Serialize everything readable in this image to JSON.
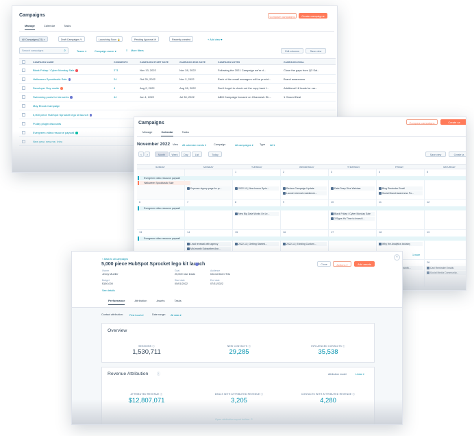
{
  "colors": {
    "accent": "#ff7a59",
    "link": "#0091ae",
    "text": "#33475b",
    "muted": "#516f90"
  },
  "campaigns": {
    "title": "Campaigns",
    "compare_btn": "Compare campaigns",
    "create_btn": "Create campaign ▾",
    "tabs": [
      "Manage",
      "Calendar",
      "Tasks"
    ],
    "views": [
      "All Campaigns (31) ×",
      "Draft Campaigns ✎",
      "Launching Soon 🔒",
      "Pending Approval ✉",
      "Recently created",
      "+ Add view ▾"
    ],
    "search_placeholder": "Search campaigns",
    "filters": [
      "Teams ▾",
      "Campaign owner ▾",
      "More filters"
    ],
    "edit_columns": "Edit columns",
    "save_view": "Save view",
    "columns": [
      "CAMPAIGN NAME",
      "COMMENTS",
      "CAMPAIGN START DATE",
      "CAMPAIGN END DATE",
      "CAMPAIGN NOTES",
      "CAMPAIGN GOAL"
    ],
    "rows": [
      {
        "name": "Black Friday / Cyber Monday Sale",
        "comments": "271",
        "start": "Nov 13, 2022",
        "end": "Nov 28, 2022",
        "notes": "Following the 2021 Campaign we're d...",
        "goal": "Close the gaps from Q3 Sal..."
      },
      {
        "name": "Halloween Spooktastic Sale",
        "comments": "24",
        "start": "Oct 25, 2022",
        "end": "Nov 2, 2022",
        "notes": "Each of the email managers will be provid...",
        "goal": "Brand awareness"
      },
      {
        "name": "Developer Day onsite",
        "comments": "4",
        "start": "Aug 2, 2022",
        "end": "Aug 26, 2022",
        "notes": "Don't forget to check out the copy back f...",
        "goal": "Additional 18 leads for car..."
      },
      {
        "name": "Swimming pools for introverts",
        "comments": "44",
        "start": "Jun 1, 2022",
        "end": "Jul 30, 2022",
        "notes": "ABM Campaign focused on Gharmesh Sh...",
        "goal": "1 Closed Deal"
      },
      {
        "name": "May Ebook Campaign",
        "comments": "",
        "start": "",
        "end": "",
        "notes": "",
        "goal": ""
      },
      {
        "name": "5,000 piece HubSpot Sprocket lego kit launch",
        "comments": "",
        "start": "",
        "end": "",
        "notes": "",
        "goal": ""
      },
      {
        "name": "Pi-day plugin discounts",
        "comments": "",
        "start": "",
        "end": "",
        "notes": "",
        "goal": ""
      },
      {
        "name": "Evergreen video resource paywall",
        "comments": "",
        "start": "",
        "end": "",
        "notes": "",
        "goal": ""
      },
      {
        "name": "New year, new me, Intro",
        "comments": "",
        "start": "",
        "end": "",
        "notes": "",
        "goal": ""
      }
    ]
  },
  "calendar": {
    "title": "Campaigns",
    "compare_btn": "Compare campaigns",
    "create_btn": "Create ca",
    "tabs": [
      "Manage",
      "Calendar",
      "Tasks"
    ],
    "month": "November 2022",
    "view_label": "View",
    "view_value": "All calendar events ▾",
    "campaign_label": "Campaign",
    "campaign_value": "All campaigns ▾",
    "type_label": "Type",
    "type_value": "All ▾",
    "nav": [
      "<",
      ">"
    ],
    "modes": [
      "Month",
      "Week",
      "Day",
      "List"
    ],
    "today": "Today",
    "save_view": "Save view",
    "create_task": "Create ta",
    "weekdays": [
      "SUNDAY",
      "MONDAY",
      "TUESDAY",
      "WEDNESDAY",
      "THURSDAY",
      "FRIDAY",
      "SATURDAY"
    ],
    "week1": {
      "dates": [
        "",
        "",
        "1",
        "2",
        "3",
        "4",
        "5"
      ],
      "bands": [
        "Evergreen video resource paywall",
        "Halloween Spooktastic Sale"
      ],
      "events": [
        {
          "col": 1,
          "row": 0,
          "text": "Expense signup page for pr..."
        },
        {
          "col": 2,
          "row": 0,
          "text": "2022-11 | New bonus Sprin..."
        },
        {
          "col": 3,
          "row": 0,
          "text": "Review Campaign Update"
        },
        {
          "col": 3,
          "row": 1,
          "text": "Launch internal enablemen..."
        },
        {
          "col": 4,
          "row": 0,
          "text": "Data Deep Dive Webinar"
        },
        {
          "col": 5,
          "row": 0,
          "text": "Blog Reminder Email"
        },
        {
          "col": 5,
          "row": 1,
          "text": "Social Brand Awareness Po..."
        }
      ]
    },
    "week2": {
      "dates": [
        "6",
        "7",
        "8",
        "9",
        "10",
        "11",
        "12"
      ],
      "bands": [
        "Evergreen video resource paywall"
      ],
      "events": [
        {
          "col": 2,
          "row": 0,
          "text": "New Big Data Works Un Le..."
        },
        {
          "col": 4,
          "row": 0,
          "text": "Black Friday / Cyber Monday Sale"
        },
        {
          "col": 4,
          "row": 1,
          "text": "3 Signs It's Time to Invest i..."
        }
      ]
    },
    "week3": {
      "dates": [
        "13",
        "14",
        "15",
        "16",
        "17",
        "18",
        "19"
      ],
      "bands": [
        "Evergreen video resource paywall"
      ],
      "events": [
        {
          "col": 1,
          "row": 0,
          "text": "Lead renewal with agency"
        },
        {
          "col": 1,
          "row": 1,
          "text": "Mid-month Subscriber Ann..."
        },
        {
          "col": 2,
          "row": 0,
          "text": "2022-11 | Getting Started..."
        },
        {
          "col": 3,
          "row": 0,
          "text": "2022-11 | Existing Custom..."
        },
        {
          "col": 5,
          "row": 0,
          "text": "Why the Analytics Industry"
        }
      ]
    },
    "more_link": "1 more",
    "week4_dates": [
      "",
      "",
      "",
      "",
      "",
      "",
      "26"
    ],
    "week4_events": [
      "Cart Reminder Emails",
      "Social Media Community..."
    ],
    "partial_text": "ppe troubles | Mid-month..."
  },
  "detail": {
    "back_link": "< Back to all campaigns",
    "title": "5,000 piece HubSpot Sprocket lego kit launch",
    "clone_btn": "Clone",
    "actions_btn": "Actions ▾",
    "add_assets_btn": "Add assets",
    "props": [
      {
        "label": "Owner",
        "value": "Jenny Mueller"
      },
      {
        "label": "Goal",
        "value": "25,000 new leads"
      },
      {
        "label": "Audience",
        "value": "Introverted CTOs"
      },
      {
        "label": "Budget",
        "value": "$150,000"
      },
      {
        "label": "Start date",
        "value": "05/01/2022"
      },
      {
        "label": "End date",
        "value": "07/31/2022"
      }
    ],
    "see_details": "See details",
    "tabs": [
      "Performance",
      "Attribution",
      "Assets",
      "Tasks"
    ],
    "contact_attr_label": "Contact attribution:",
    "contact_attr_value": "First touch ▾",
    "date_range_label": "Date range:",
    "date_range_value": "All data ▾",
    "overview": {
      "title": "Overview",
      "metrics": [
        {
          "label": "SESSIONS ⓘ",
          "value": "1,530,711"
        },
        {
          "label": "NEW CONTACTS ⓘ",
          "value": "29,285"
        },
        {
          "label": "INFLUENCED CONTACTS ⓘ",
          "value": "35,538"
        }
      ]
    },
    "revenue": {
      "title": "Revenue Attribution",
      "model_label": "Attribution model",
      "model_value": "Linear ▾",
      "metrics": [
        {
          "label": "ATTRIBUTED REVENUE ⓘ",
          "value": "$12,807,071"
        },
        {
          "label": "DEALS WITH ATTRIBUTED REVENUE ⓘ",
          "value": "3,205"
        },
        {
          "label": "CONTACTS WITH ATTRIBUTED REVENUE ⓘ",
          "value": "4,280"
        }
      ],
      "report_link": "Open attribution report builder ↗"
    }
  }
}
